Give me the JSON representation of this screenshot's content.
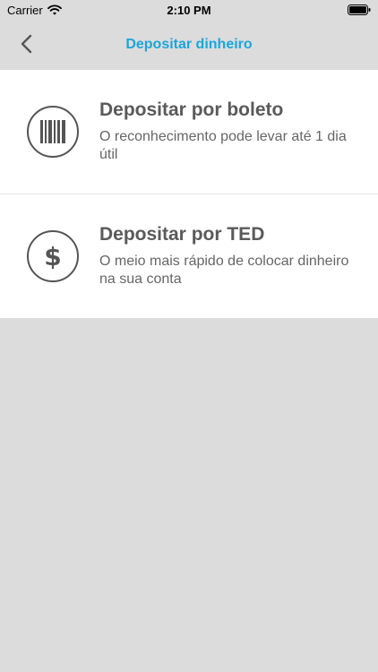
{
  "status_bar": {
    "carrier": "Carrier",
    "time": "2:10 PM"
  },
  "header": {
    "title": "Depositar dinheiro",
    "accent_color": "#1ba6db"
  },
  "options": [
    {
      "title": "Depositar por boleto",
      "description": "O reconhecimento pode levar até 1 dia útil",
      "icon": "barcode-icon"
    },
    {
      "title": "Depositar por TED",
      "description": "O meio mais rápido de colocar dinheiro na sua conta",
      "icon": "dollar-icon",
      "icon_glyph": "$"
    }
  ]
}
